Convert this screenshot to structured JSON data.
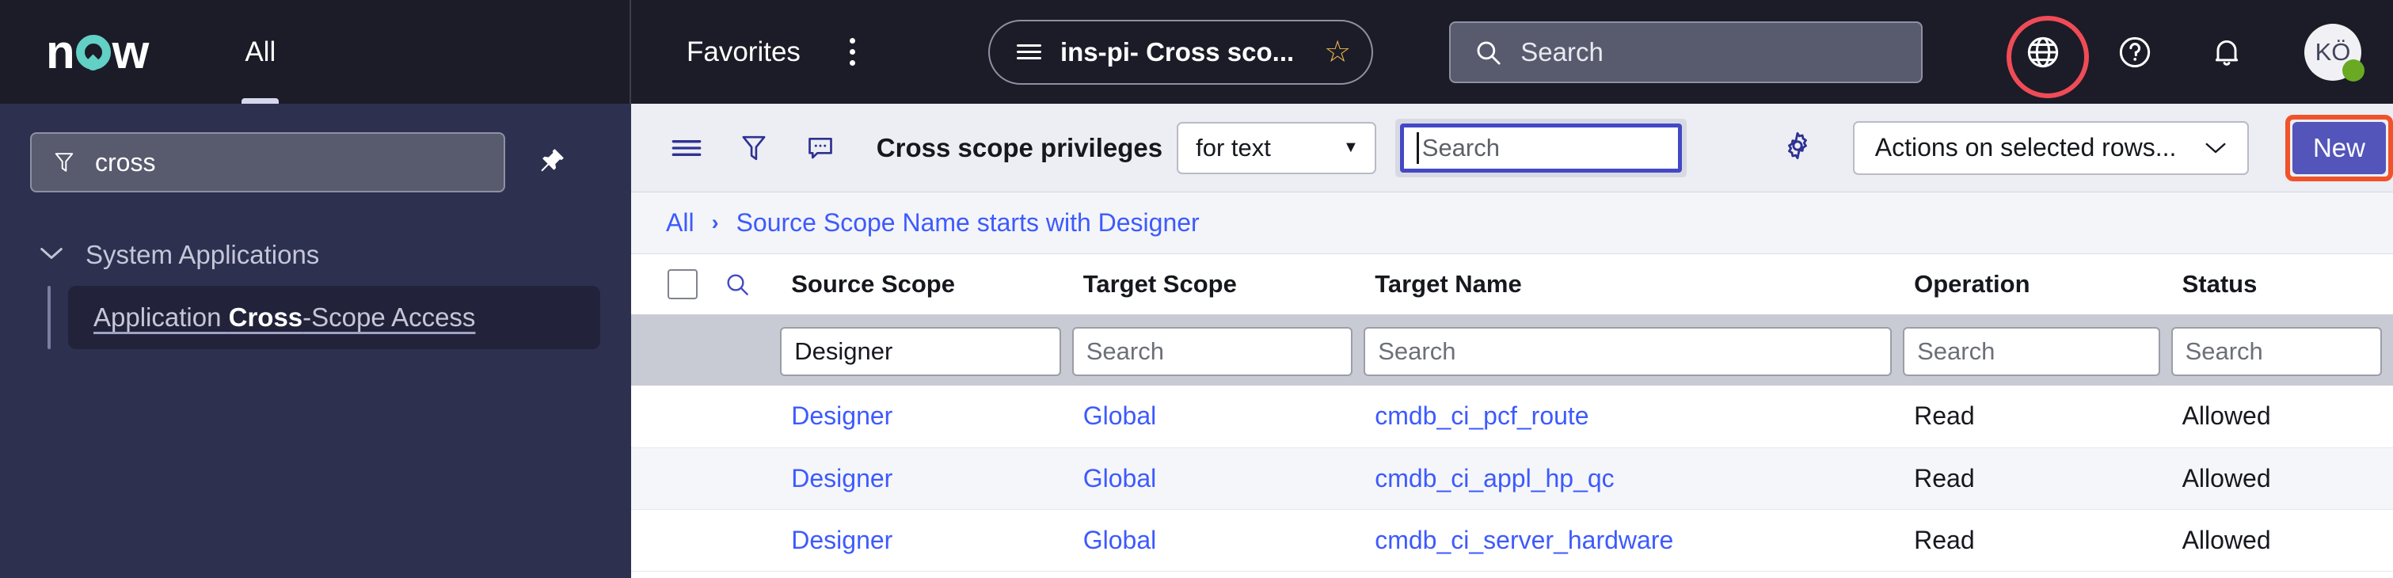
{
  "topbar": {
    "logo_text_before": "n",
    "logo_text_after": "w",
    "nav_all": "All",
    "favorites": "Favorites",
    "kebab_icon": "more-vertical-icon",
    "scope_pill": {
      "list_icon": "list-icon",
      "title": "ins-pi- Cross sco...",
      "star_icon": "star-outline-icon",
      "star_glyph": "☆"
    },
    "search": {
      "icon": "search-icon",
      "placeholder": "Search",
      "value": "Search"
    },
    "icons": {
      "globe": "globe-icon",
      "help": "help-circle-icon",
      "bell": "bell-icon"
    },
    "avatar": {
      "initials": "KÖ",
      "presence": "online"
    }
  },
  "sidebar": {
    "filter": {
      "icon": "funnel-icon",
      "value": "cross",
      "placeholder": "Filter"
    },
    "pin_icon": "pin-icon",
    "group": {
      "chevron": "chevron-down-icon",
      "label": "System Applications"
    },
    "nav_item": {
      "prefix": "Application ",
      "highlight": "Cross",
      "suffix": "-Scope Access"
    }
  },
  "toolbar": {
    "menu_icon": "hamburger-menu-icon",
    "filter_icon": "funnel-icon",
    "comment_icon": "comment-bubble-icon",
    "title": "Cross scope privileges",
    "search_field_select": "for text",
    "search_placeholder": "Search",
    "search_value": "Search",
    "gear_icon": "gear-icon",
    "actions_label": "Actions on selected rows...",
    "new_label": "New"
  },
  "breadcrumb": {
    "root": "All",
    "separator": "›",
    "condition": "Source Scope Name starts with Designer"
  },
  "table": {
    "select_all_checkbox": "select-all-checkbox",
    "zoom_icon": "search-icon",
    "columns": [
      {
        "key": "source_scope",
        "label": "Source Scope"
      },
      {
        "key": "target_scope",
        "label": "Target Scope"
      },
      {
        "key": "target_name",
        "label": "Target Name"
      },
      {
        "key": "operation",
        "label": "Operation"
      },
      {
        "key": "status",
        "label": "Status"
      }
    ],
    "filters": {
      "source_scope": {
        "value": "Designer",
        "placeholder": "Search",
        "filled": true
      },
      "target_scope": {
        "value": "Search",
        "placeholder": "Search",
        "filled": false
      },
      "target_name": {
        "value": "Search",
        "placeholder": "Search",
        "filled": false
      },
      "operation": {
        "value": "Search",
        "placeholder": "Search",
        "filled": false
      },
      "status": {
        "value": "Search",
        "placeholder": "Search",
        "filled": false
      }
    },
    "rows": [
      {
        "source_scope": "Designer",
        "target_scope": "Global",
        "target_name": "cmdb_ci_pcf_route",
        "operation": "Read",
        "status": "Allowed"
      },
      {
        "source_scope": "Designer",
        "target_scope": "Global",
        "target_name": "cmdb_ci_appl_hp_qc",
        "operation": "Read",
        "status": "Allowed"
      },
      {
        "source_scope": "Designer",
        "target_scope": "Global",
        "target_name": "cmdb_ci_server_hardware",
        "operation": "Read",
        "status": "Allowed"
      }
    ]
  },
  "colors": {
    "topbar_bg": "#1b1c27",
    "sidebar_bg": "#2e3050",
    "accent_teal": "#62d0c4",
    "link_blue": "#3d5afe",
    "primary_button": "#5355ba",
    "highlight_red": "#f04b56",
    "highlight_orange": "#f0522a",
    "star_gold": "#f0b952",
    "presence_green": "#6aaa23"
  }
}
